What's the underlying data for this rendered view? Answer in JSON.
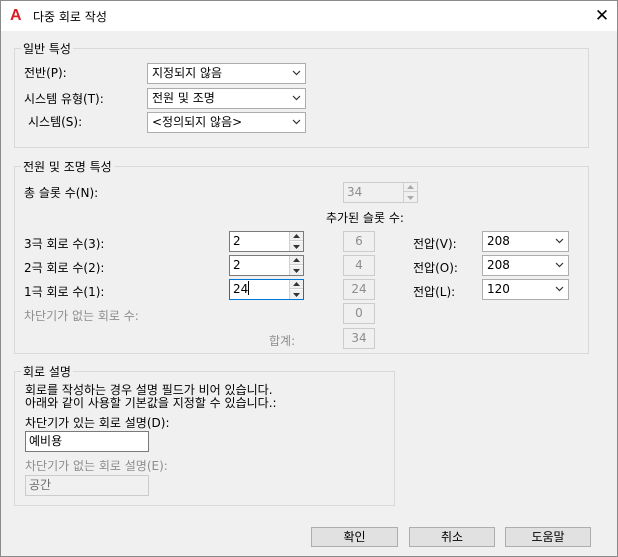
{
  "window": {
    "title": "다중 회로 작성",
    "app_icon_glyph": "A",
    "close_glyph": "✕"
  },
  "general": {
    "legend": "일반 특성",
    "phase_label": "전반(P):",
    "phase_value": "지정되지 않음",
    "system_type_label": "시스템 유형(T):",
    "system_type_value": "전원 및 조명",
    "system_label": "시스템(S):",
    "system_value": "<정의되지 않음>"
  },
  "power": {
    "legend": "전원 및 조명 특성",
    "total_slots_label": "총 슬롯 수(N):",
    "total_slots_value": "34",
    "added_slots_label": "추가된 슬롯 수:",
    "rows": [
      {
        "label": "3극 회로 수(3):",
        "value": "2",
        "slots": "6",
        "voltage_label": "전압(V):",
        "voltage": "208"
      },
      {
        "label": "2극 회로 수(2):",
        "value": "2",
        "slots": "4",
        "voltage_label": "전압(O):",
        "voltage": "208"
      },
      {
        "label": "1극 회로 수(1):",
        "value": "24",
        "slots": "24",
        "voltage_label": "전압(L):",
        "voltage": "120"
      }
    ],
    "no_breaker_label": "차단기가 없는 회로 수:",
    "no_breaker_slots": "0",
    "total_label": "합계:",
    "total_value": "34"
  },
  "description": {
    "legend": "회로 설명",
    "info_line1": "회로를 작성하는 경우 설명 필드가 비어 있습니다.",
    "info_line2": "아래와 같이 사용할 기본값을 지정할 수 있습니다.:",
    "with_breaker_label": "차단기가 있는 회로 설명(D):",
    "with_breaker_value": "예비용",
    "without_breaker_label": "차단기가 없는 회로 설명(E):",
    "without_breaker_value": "공간"
  },
  "buttons": {
    "ok": "확인",
    "cancel": "취소",
    "help": "도움말"
  },
  "colors": {
    "accent": "#d61f26",
    "dialog_bg": "#f0f0f0",
    "disabled_text": "#8d8d8d"
  }
}
